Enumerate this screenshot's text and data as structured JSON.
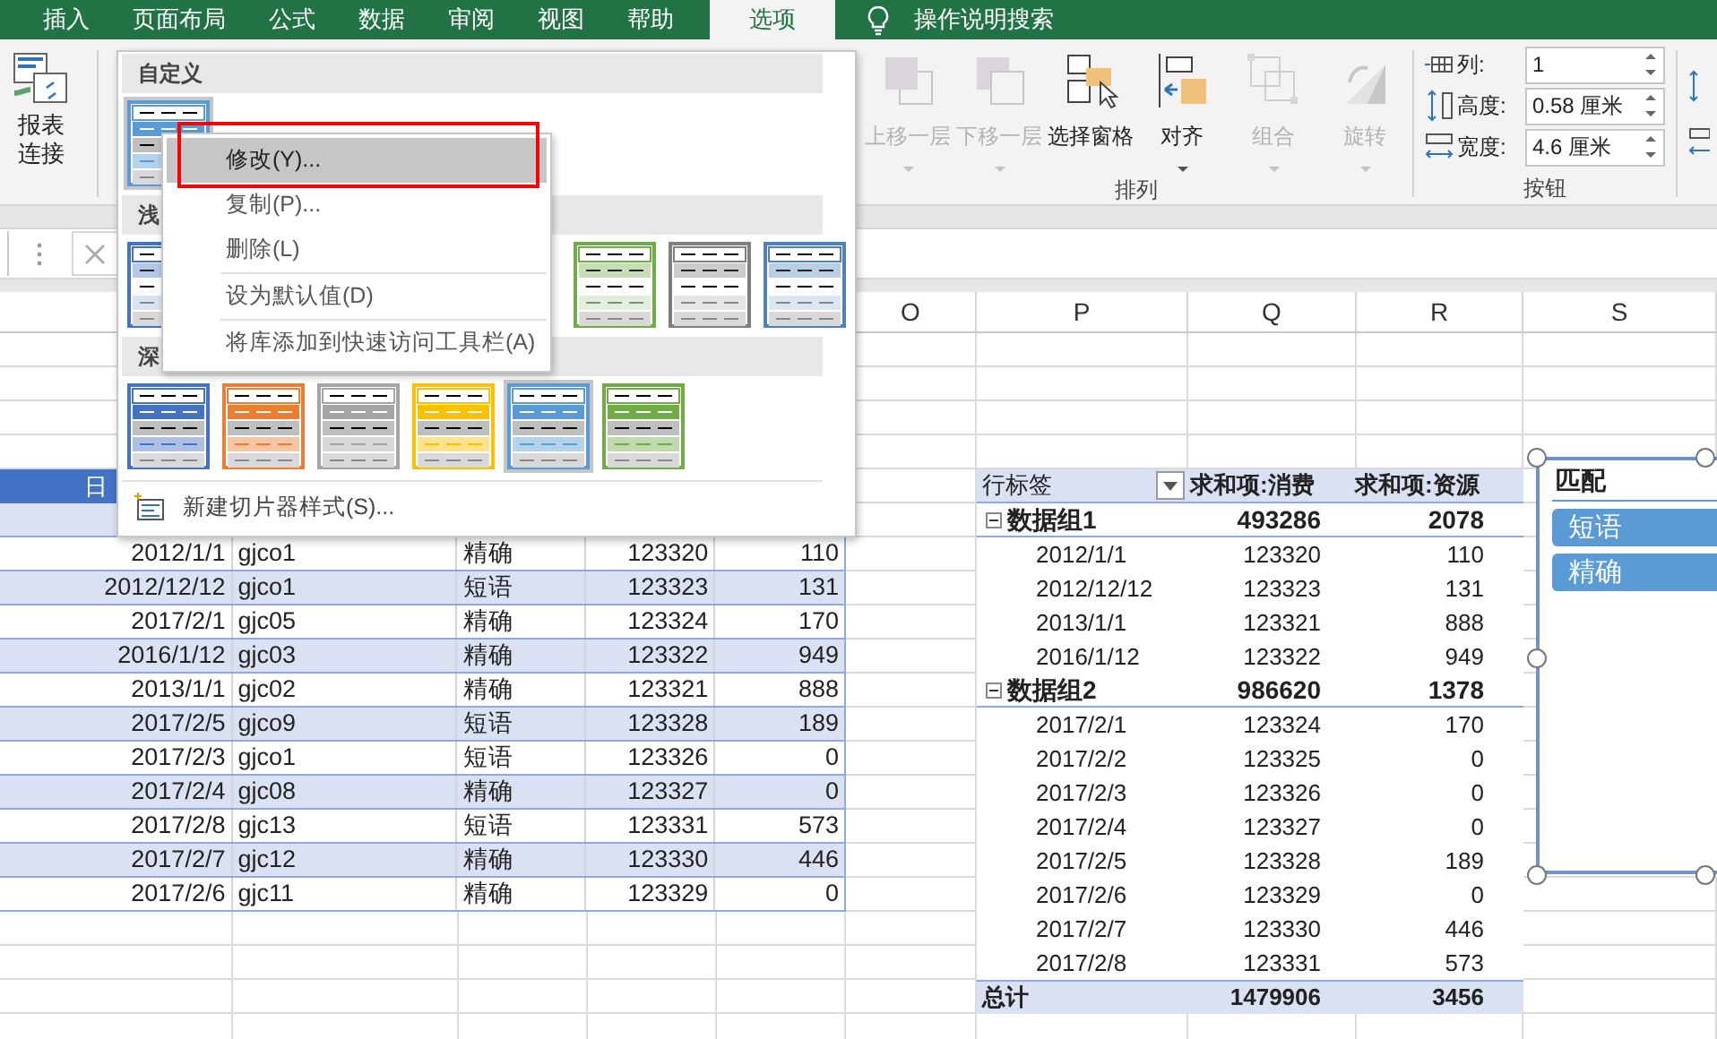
{
  "ribbon": {
    "tabs": [
      {
        "label": "插入",
        "selected": false
      },
      {
        "label": "页面布局",
        "selected": false
      },
      {
        "label": "公式",
        "selected": false
      },
      {
        "label": "数据",
        "selected": false
      },
      {
        "label": "审阅",
        "selected": false
      },
      {
        "label": "视图",
        "selected": false
      },
      {
        "label": "帮助",
        "selected": false
      },
      {
        "label": "选项",
        "selected": true
      }
    ],
    "search": {
      "label": "操作说明搜索"
    },
    "report_connection": {
      "label": "报表连接"
    },
    "arrange": {
      "label": "排列",
      "buttons": [
        {
          "kind": "forward",
          "label": "上移一层",
          "disabled": true,
          "dropdown": true
        },
        {
          "kind": "backward",
          "label": "下移一层",
          "disabled": true,
          "dropdown": true
        },
        {
          "kind": "pane",
          "label": "选择窗格",
          "disabled": false,
          "dropdown": false
        },
        {
          "kind": "align",
          "label": "对齐",
          "disabled": false,
          "dropdown": true
        },
        {
          "kind": "group",
          "label": "组合",
          "disabled": true,
          "dropdown": true
        },
        {
          "kind": "rotate",
          "label": "旋转",
          "disabled": true,
          "dropdown": true
        }
      ]
    },
    "size": {
      "label": "按钮",
      "fields": [
        {
          "kind": "columns",
          "label": "列:",
          "value": "1"
        },
        {
          "kind": "height",
          "label": "高度:",
          "value": "0.58 厘米"
        },
        {
          "kind": "width",
          "label": "宽度:",
          "value": "4.6 厘米"
        }
      ]
    }
  },
  "gallery": {
    "sections": [
      {
        "title": "自定义",
        "kind": "custom",
        "styles": [
          {
            "color": "#5b9bd5",
            "selected": true
          }
        ]
      },
      {
        "title": "浅",
        "kind": "light",
        "styles": [
          {
            "color": "#4472c4",
            "selected": false
          },
          {
            "color": "#70ad47",
            "selected": false
          },
          {
            "color": "#7f7f7f",
            "selected": false
          },
          {
            "color": "#4f81bd",
            "selected": false
          }
        ]
      },
      {
        "title": "深",
        "kind": "dark",
        "styles": [
          {
            "color": "#4472c4",
            "selected": false
          },
          {
            "color": "#ed7d31",
            "selected": false
          },
          {
            "color": "#a5a5a5",
            "selected": false
          },
          {
            "color": "#ffc000",
            "selected": false
          },
          {
            "color": "#5b9bd5",
            "selected": true
          },
          {
            "color": "#70ad47",
            "selected": false
          }
        ]
      }
    ],
    "new_style": "新建切片器样式(S)..."
  },
  "context_menu": [
    {
      "label": "修改(Y)...",
      "selected": true,
      "separator_before": false
    },
    {
      "label": "复制(P)...",
      "selected": false,
      "separator_before": false
    },
    {
      "label": "删除(L)",
      "selected": false,
      "separator_before": false
    },
    {
      "label": "设为默认值(D)",
      "selected": false,
      "separator_before": true
    },
    {
      "label": "将库添加到快速访问工具栏(A)",
      "selected": false,
      "separator_before": true
    }
  ],
  "column_headers": [
    "O",
    "P",
    "Q",
    "R",
    "S"
  ],
  "table": {
    "header": "日",
    "rows": [
      {
        "date": "2012/1/1",
        "code": "gjco1",
        "match": "精确",
        "spend": "123320",
        "resource": "110"
      },
      {
        "date": "2012/12/12",
        "code": "gjco1",
        "match": "短语",
        "spend": "123323",
        "resource": "131"
      },
      {
        "date": "2017/2/1",
        "code": "gjc05",
        "match": "精确",
        "spend": "123324",
        "resource": "170"
      },
      {
        "date": "2016/1/12",
        "code": "gjc03",
        "match": "精确",
        "spend": "123322",
        "resource": "949"
      },
      {
        "date": "2013/1/1",
        "code": "gjc02",
        "match": "精确",
        "spend": "123321",
        "resource": "888"
      },
      {
        "date": "2017/2/5",
        "code": "gjco9",
        "match": "短语",
        "spend": "123328",
        "resource": "189"
      },
      {
        "date": "2017/2/3",
        "code": "gjco1",
        "match": "短语",
        "spend": "123326",
        "resource": "0"
      },
      {
        "date": "2017/2/4",
        "code": "gjc08",
        "match": "精确",
        "spend": "123327",
        "resource": "0"
      },
      {
        "date": "2017/2/8",
        "code": "gjc13",
        "match": "短语",
        "spend": "123331",
        "resource": "573"
      },
      {
        "date": "2017/2/7",
        "code": "gjc12",
        "match": "精确",
        "spend": "123330",
        "resource": "446"
      },
      {
        "date": "2017/2/6",
        "code": "gjc11",
        "match": "精确",
        "spend": "123329",
        "resource": "0"
      }
    ]
  },
  "pivot": {
    "columns": [
      "行标签",
      "求和项:消费",
      "求和项:资源"
    ],
    "groups": [
      {
        "label": "数据组1",
        "expanded": true,
        "spend": "493286",
        "resource": "2078",
        "children": [
          {
            "label": "2012/1/1",
            "spend": "123320",
            "resource": "110"
          },
          {
            "label": "2012/12/12",
            "spend": "123323",
            "resource": "131"
          },
          {
            "label": "2013/1/1",
            "spend": "123321",
            "resource": "888"
          },
          {
            "label": "2016/1/12",
            "spend": "123322",
            "resource": "949"
          }
        ]
      },
      {
        "label": "数据组2",
        "expanded": true,
        "spend": "986620",
        "resource": "1378",
        "children": [
          {
            "label": "2017/2/1",
            "spend": "123324",
            "resource": "170"
          },
          {
            "label": "2017/2/2",
            "spend": "123325",
            "resource": "0"
          },
          {
            "label": "2017/2/3",
            "spend": "123326",
            "resource": "0"
          },
          {
            "label": "2017/2/4",
            "spend": "123327",
            "resource": "0"
          },
          {
            "label": "2017/2/5",
            "spend": "123328",
            "resource": "189"
          },
          {
            "label": "2017/2/6",
            "spend": "123329",
            "resource": "0"
          },
          {
            "label": "2017/2/7",
            "spend": "123330",
            "resource": "446"
          },
          {
            "label": "2017/2/8",
            "spend": "123331",
            "resource": "573"
          }
        ]
      }
    ],
    "total": {
      "label": "总计",
      "spend": "1479906",
      "resource": "3456"
    }
  },
  "slicer": {
    "title": "匹配",
    "items": [
      {
        "label": "短语",
        "selected": true
      },
      {
        "label": "精确",
        "selected": true
      }
    ]
  }
}
